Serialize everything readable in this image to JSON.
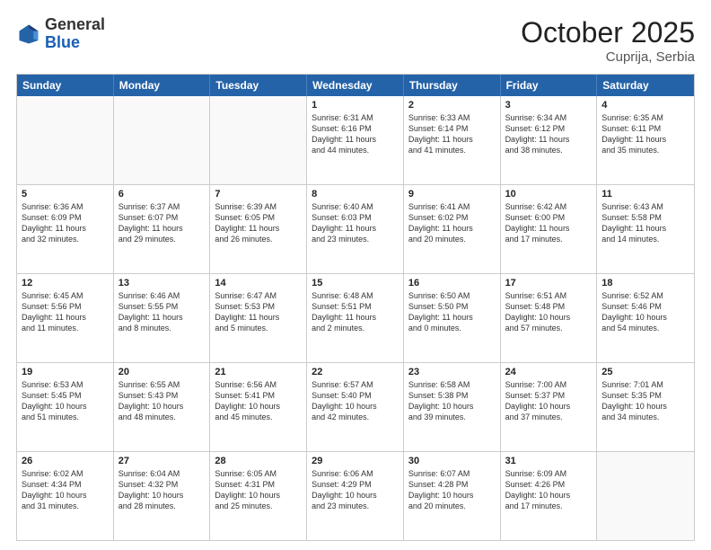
{
  "header": {
    "logo_general": "General",
    "logo_blue": "Blue",
    "month_title": "October 2025",
    "subtitle": "Cuprija, Serbia"
  },
  "days_of_week": [
    "Sunday",
    "Monday",
    "Tuesday",
    "Wednesday",
    "Thursday",
    "Friday",
    "Saturday"
  ],
  "weeks": [
    [
      {
        "day": "",
        "empty": true
      },
      {
        "day": "",
        "empty": true
      },
      {
        "day": "",
        "empty": true
      },
      {
        "day": "1",
        "lines": [
          "Sunrise: 6:31 AM",
          "Sunset: 6:16 PM",
          "Daylight: 11 hours",
          "and 44 minutes."
        ]
      },
      {
        "day": "2",
        "lines": [
          "Sunrise: 6:33 AM",
          "Sunset: 6:14 PM",
          "Daylight: 11 hours",
          "and 41 minutes."
        ]
      },
      {
        "day": "3",
        "lines": [
          "Sunrise: 6:34 AM",
          "Sunset: 6:12 PM",
          "Daylight: 11 hours",
          "and 38 minutes."
        ]
      },
      {
        "day": "4",
        "lines": [
          "Sunrise: 6:35 AM",
          "Sunset: 6:11 PM",
          "Daylight: 11 hours",
          "and 35 minutes."
        ]
      }
    ],
    [
      {
        "day": "5",
        "lines": [
          "Sunrise: 6:36 AM",
          "Sunset: 6:09 PM",
          "Daylight: 11 hours",
          "and 32 minutes."
        ]
      },
      {
        "day": "6",
        "lines": [
          "Sunrise: 6:37 AM",
          "Sunset: 6:07 PM",
          "Daylight: 11 hours",
          "and 29 minutes."
        ]
      },
      {
        "day": "7",
        "lines": [
          "Sunrise: 6:39 AM",
          "Sunset: 6:05 PM",
          "Daylight: 11 hours",
          "and 26 minutes."
        ]
      },
      {
        "day": "8",
        "lines": [
          "Sunrise: 6:40 AM",
          "Sunset: 6:03 PM",
          "Daylight: 11 hours",
          "and 23 minutes."
        ]
      },
      {
        "day": "9",
        "lines": [
          "Sunrise: 6:41 AM",
          "Sunset: 6:02 PM",
          "Daylight: 11 hours",
          "and 20 minutes."
        ]
      },
      {
        "day": "10",
        "lines": [
          "Sunrise: 6:42 AM",
          "Sunset: 6:00 PM",
          "Daylight: 11 hours",
          "and 17 minutes."
        ]
      },
      {
        "day": "11",
        "lines": [
          "Sunrise: 6:43 AM",
          "Sunset: 5:58 PM",
          "Daylight: 11 hours",
          "and 14 minutes."
        ]
      }
    ],
    [
      {
        "day": "12",
        "lines": [
          "Sunrise: 6:45 AM",
          "Sunset: 5:56 PM",
          "Daylight: 11 hours",
          "and 11 minutes."
        ]
      },
      {
        "day": "13",
        "lines": [
          "Sunrise: 6:46 AM",
          "Sunset: 5:55 PM",
          "Daylight: 11 hours",
          "and 8 minutes."
        ]
      },
      {
        "day": "14",
        "lines": [
          "Sunrise: 6:47 AM",
          "Sunset: 5:53 PM",
          "Daylight: 11 hours",
          "and 5 minutes."
        ]
      },
      {
        "day": "15",
        "lines": [
          "Sunrise: 6:48 AM",
          "Sunset: 5:51 PM",
          "Daylight: 11 hours",
          "and 2 minutes."
        ]
      },
      {
        "day": "16",
        "lines": [
          "Sunrise: 6:50 AM",
          "Sunset: 5:50 PM",
          "Daylight: 11 hours",
          "and 0 minutes."
        ]
      },
      {
        "day": "17",
        "lines": [
          "Sunrise: 6:51 AM",
          "Sunset: 5:48 PM",
          "Daylight: 10 hours",
          "and 57 minutes."
        ]
      },
      {
        "day": "18",
        "lines": [
          "Sunrise: 6:52 AM",
          "Sunset: 5:46 PM",
          "Daylight: 10 hours",
          "and 54 minutes."
        ]
      }
    ],
    [
      {
        "day": "19",
        "lines": [
          "Sunrise: 6:53 AM",
          "Sunset: 5:45 PM",
          "Daylight: 10 hours",
          "and 51 minutes."
        ]
      },
      {
        "day": "20",
        "lines": [
          "Sunrise: 6:55 AM",
          "Sunset: 5:43 PM",
          "Daylight: 10 hours",
          "and 48 minutes."
        ]
      },
      {
        "day": "21",
        "lines": [
          "Sunrise: 6:56 AM",
          "Sunset: 5:41 PM",
          "Daylight: 10 hours",
          "and 45 minutes."
        ]
      },
      {
        "day": "22",
        "lines": [
          "Sunrise: 6:57 AM",
          "Sunset: 5:40 PM",
          "Daylight: 10 hours",
          "and 42 minutes."
        ]
      },
      {
        "day": "23",
        "lines": [
          "Sunrise: 6:58 AM",
          "Sunset: 5:38 PM",
          "Daylight: 10 hours",
          "and 39 minutes."
        ]
      },
      {
        "day": "24",
        "lines": [
          "Sunrise: 7:00 AM",
          "Sunset: 5:37 PM",
          "Daylight: 10 hours",
          "and 37 minutes."
        ]
      },
      {
        "day": "25",
        "lines": [
          "Sunrise: 7:01 AM",
          "Sunset: 5:35 PM",
          "Daylight: 10 hours",
          "and 34 minutes."
        ]
      }
    ],
    [
      {
        "day": "26",
        "lines": [
          "Sunrise: 6:02 AM",
          "Sunset: 4:34 PM",
          "Daylight: 10 hours",
          "and 31 minutes."
        ]
      },
      {
        "day": "27",
        "lines": [
          "Sunrise: 6:04 AM",
          "Sunset: 4:32 PM",
          "Daylight: 10 hours",
          "and 28 minutes."
        ]
      },
      {
        "day": "28",
        "lines": [
          "Sunrise: 6:05 AM",
          "Sunset: 4:31 PM",
          "Daylight: 10 hours",
          "and 25 minutes."
        ]
      },
      {
        "day": "29",
        "lines": [
          "Sunrise: 6:06 AM",
          "Sunset: 4:29 PM",
          "Daylight: 10 hours",
          "and 23 minutes."
        ]
      },
      {
        "day": "30",
        "lines": [
          "Sunrise: 6:07 AM",
          "Sunset: 4:28 PM",
          "Daylight: 10 hours",
          "and 20 minutes."
        ]
      },
      {
        "day": "31",
        "lines": [
          "Sunrise: 6:09 AM",
          "Sunset: 4:26 PM",
          "Daylight: 10 hours",
          "and 17 minutes."
        ]
      },
      {
        "day": "",
        "empty": true
      }
    ]
  ]
}
